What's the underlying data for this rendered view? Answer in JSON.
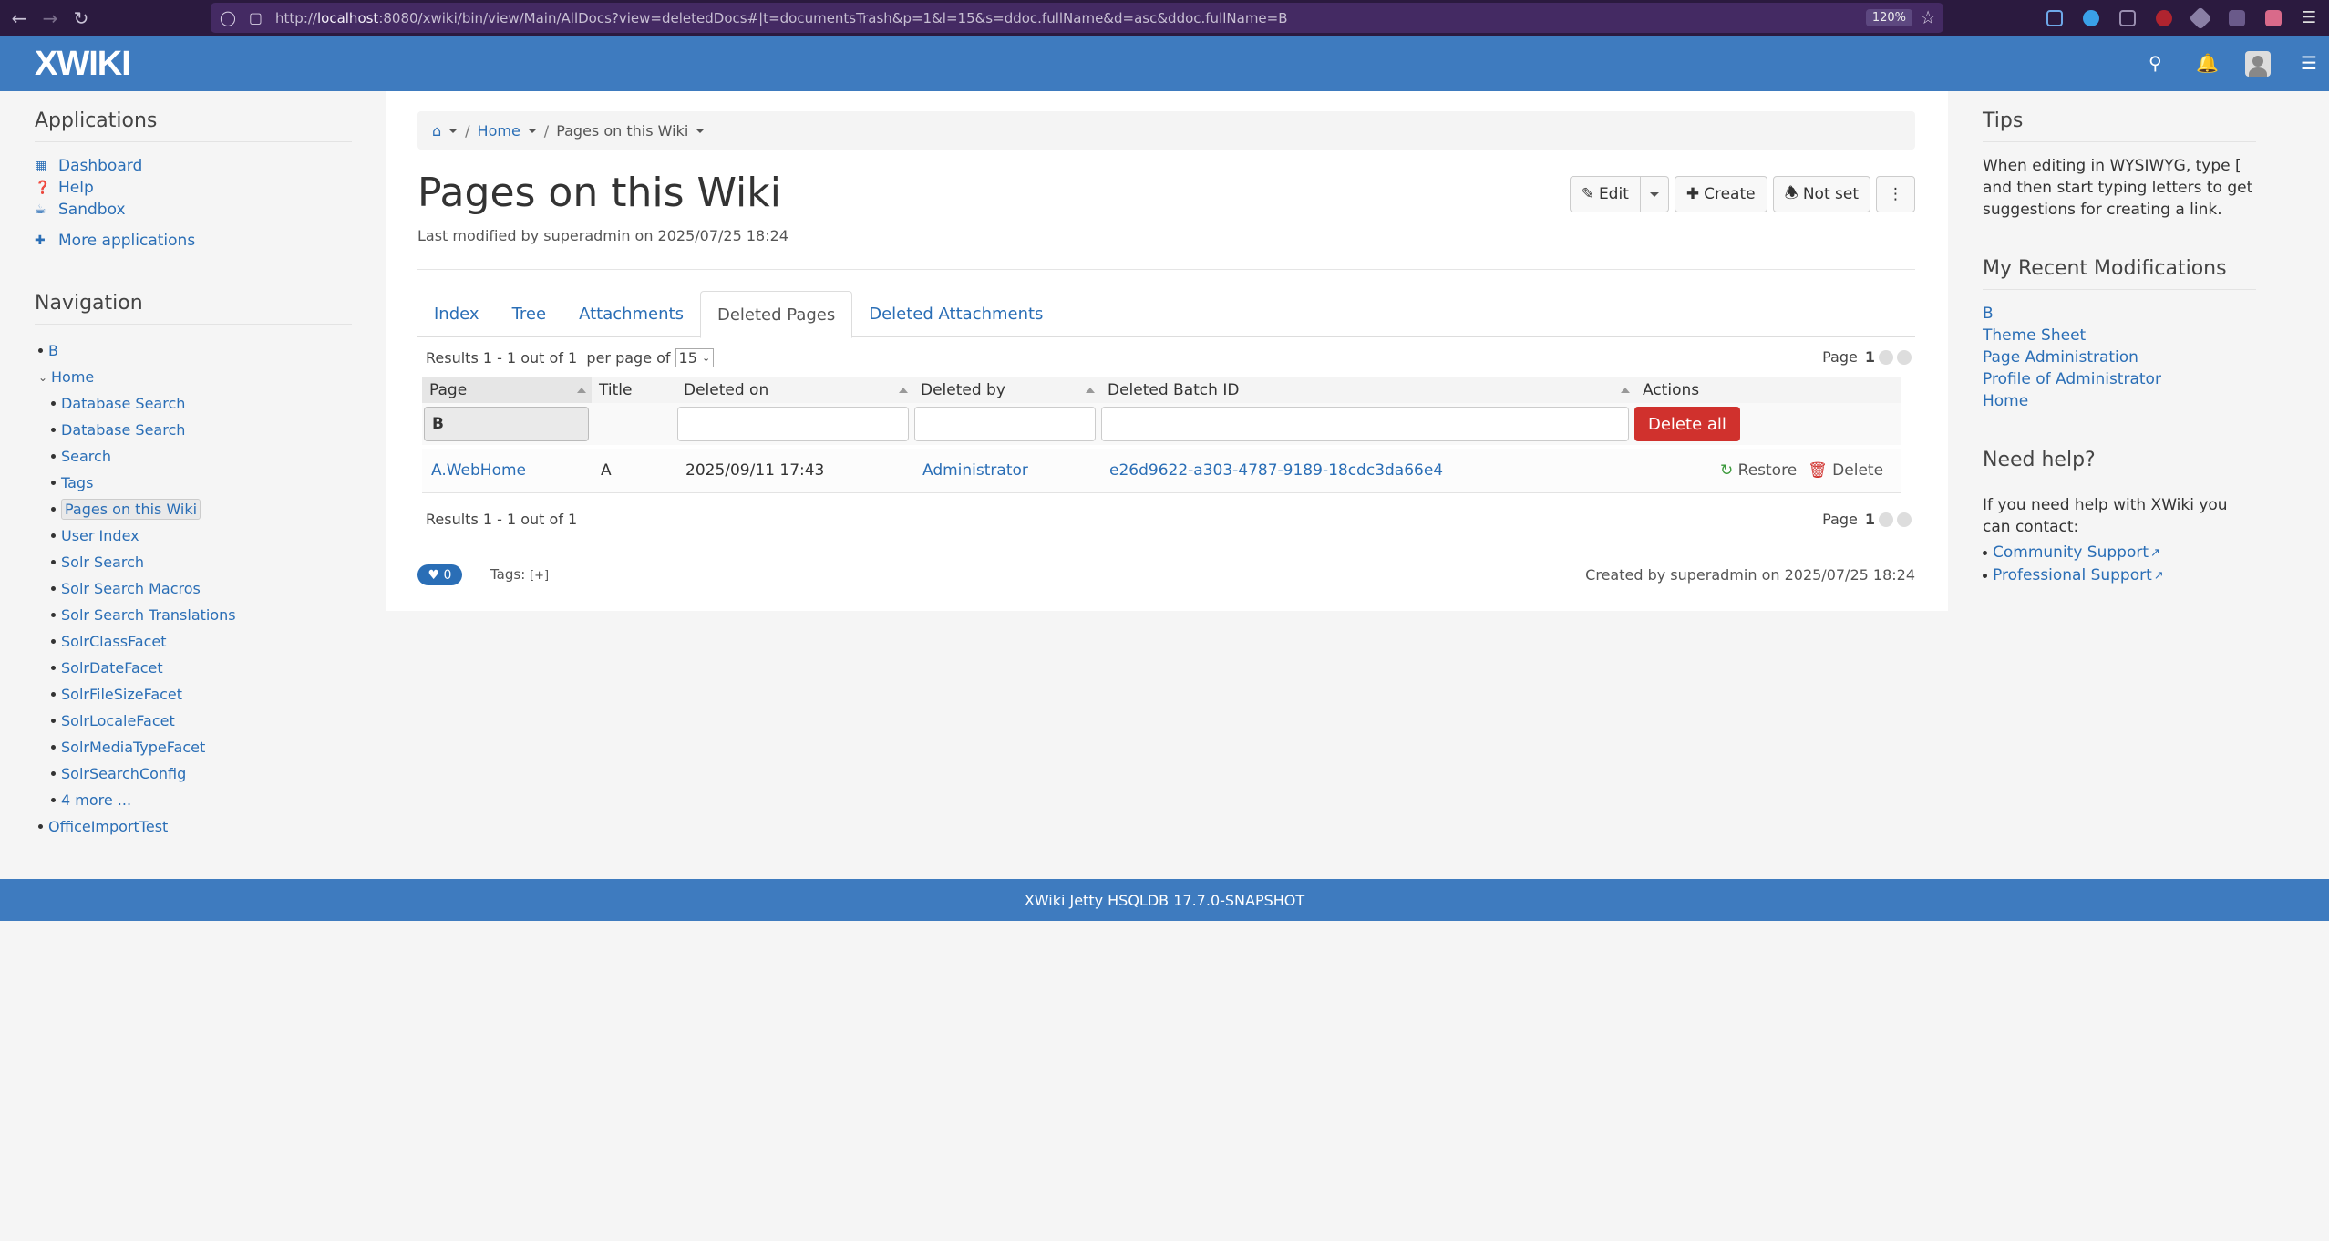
{
  "browser": {
    "url_prefix": "http://",
    "url_host": "localhost",
    "url_rest": ":8080/xwiki/bin/view/Main/AllDocs?view=deletedDocs#|t=documentsTrash&p=1&l=15&s=ddoc.fullName&d=asc&ddoc.fullName=B",
    "zoom": "120%"
  },
  "header": {
    "logo": "XWIKI"
  },
  "applications": {
    "title": "Applications",
    "items": [
      "Dashboard",
      "Help",
      "Sandbox"
    ],
    "more": "More applications"
  },
  "navigation": {
    "title": "Navigation",
    "top1": "B",
    "home": "Home",
    "children": [
      "Database Search",
      "Database Search",
      "Search",
      "Tags",
      "Pages on this Wiki",
      "User Index",
      "Solr Search",
      "Solr Search Macros",
      "Solr Search Translations",
      "SolrClassFacet",
      "SolrDateFacet",
      "SolrFileSizeFacet",
      "SolrLocaleFacet",
      "SolrMediaTypeFacet",
      "SolrSearchConfig",
      "4 more ..."
    ],
    "top3": "OfficeImportTest"
  },
  "breadcrumb": {
    "home": "Home",
    "current": "Pages on this Wiki"
  },
  "page": {
    "title": "Pages on this Wiki",
    "last_modified": "Last modified by superadmin on 2025/07/25 18:24",
    "created": "Created by superadmin on 2025/07/25 18:24",
    "likes": "0",
    "tags_label": "Tags:",
    "tags_add": "[+]"
  },
  "toolbar": {
    "edit": "Edit",
    "create": "Create",
    "notifications": "Not set"
  },
  "tabs": [
    "Index",
    "Tree",
    "Attachments",
    "Deleted Pages",
    "Deleted Attachments"
  ],
  "table": {
    "results_top": "Results 1 - 1 out of 1",
    "per_page_label": "per page of",
    "per_page_value": "15",
    "page_label": "Page",
    "page_number": "1",
    "results_bottom": "Results 1 - 1 out of 1",
    "columns": [
      "Page",
      "Title",
      "Deleted on",
      "Deleted by",
      "Deleted Batch ID",
      "Actions"
    ],
    "filter_page": "B",
    "delete_all": "Delete all",
    "rows": [
      {
        "page": "A.WebHome",
        "title": "A",
        "deleted_on": "2025/09/11 17:43",
        "deleted_by": "Administrator",
        "batch_id": "e26d9622-a303-4787-9189-18cdc3da66e4",
        "restore": "Restore",
        "delete": "Delete"
      }
    ]
  },
  "tips": {
    "title": "Tips",
    "text": "When editing in WYSIWYG, type [ and then start typing letters to get suggestions for creating a link."
  },
  "recent": {
    "title": "My Recent Modifications",
    "items": [
      "B",
      "Theme Sheet",
      "Page Administration",
      "Profile of Administrator",
      "Home"
    ]
  },
  "help": {
    "title": "Need help?",
    "text": "If you need help with XWiki you can contact:",
    "items": [
      "Community Support",
      "Professional Support"
    ]
  },
  "footer": {
    "text": "XWiki Jetty HSQLDB 17.7.0-SNAPSHOT"
  },
  "colors": {
    "brand": "#3e7bbf",
    "link": "#2a6eb6",
    "danger": "#d0312d"
  }
}
